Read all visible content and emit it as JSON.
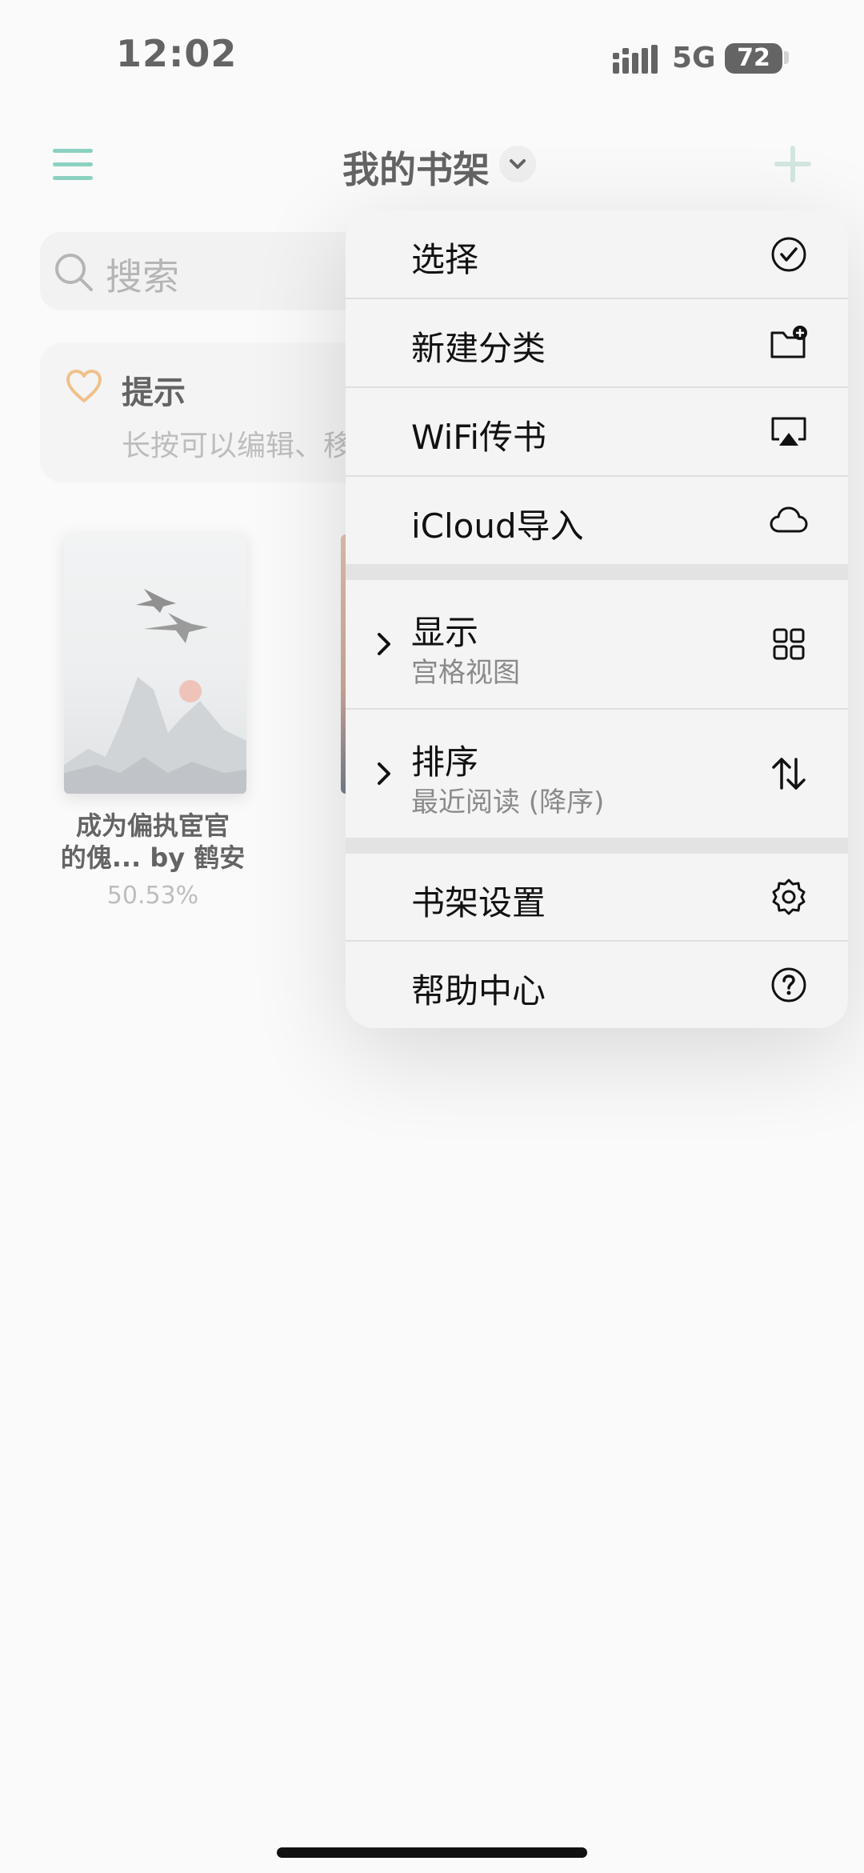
{
  "status_bar": {
    "time": "12:02",
    "network": "5G",
    "battery": "72"
  },
  "header": {
    "title": "我的书架"
  },
  "search": {
    "placeholder": "搜索"
  },
  "tip": {
    "title": "提示",
    "description": "长按可以编辑、移"
  },
  "books": [
    {
      "title_line1": "成为偏执宦官",
      "title_line2": "的傀... by 鹤安",
      "progress": "50.53%"
    }
  ],
  "menu": {
    "items": [
      {
        "label": "选择",
        "icon": "check-circle-icon"
      },
      {
        "label": "新建分类",
        "icon": "folder-plus-icon"
      },
      {
        "label": "WiFi传书",
        "icon": "airplay-icon"
      },
      {
        "label": "iCloud导入",
        "icon": "cloud-icon"
      },
      {
        "label": "显示",
        "value": "宫格视图",
        "icon": "grid-icon"
      },
      {
        "label": "排序",
        "value": "最近阅读 (降序)",
        "icon": "sort-arrows-icon"
      },
      {
        "label": "书架设置",
        "icon": "gear-icon"
      },
      {
        "label": "帮助中心",
        "icon": "help-circle-icon"
      }
    ]
  },
  "colors": {
    "accent": "#4db8a0",
    "tip_heart": "#e8a04c"
  }
}
